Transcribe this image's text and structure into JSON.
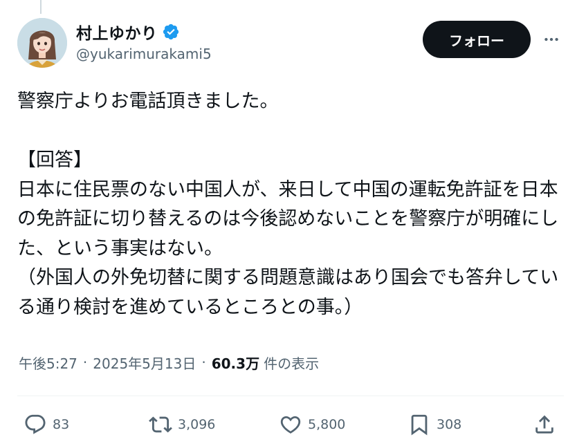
{
  "author": {
    "display_name": "村上ゆかり",
    "handle": "@yukarimurakami5",
    "verified": true,
    "avatar_icon": "profile-avatar-illustration"
  },
  "header": {
    "follow_label": "フォロー",
    "more_icon": "more-horizontal-icon"
  },
  "tweet": {
    "text": "警察庁よりお電話頂きました。\n\n【回答】\n日本に住民票のない中国人が、来日して中国の運転免許証を日本の免許証に切り替えるのは今後認めないことを警察庁が明確にした、という事実はない。\n（外国人の外免切替に関する問題意識はあり国会でも答弁している通り検討を進めているところとの事。）"
  },
  "meta": {
    "time": "午後5:27",
    "separator": "·",
    "date": "2025年5月13日",
    "views_count": "60.3万",
    "views_label": "件の表示"
  },
  "actions": {
    "reply_count": "83",
    "retweet_count": "3,096",
    "like_count": "5,800",
    "bookmark_count": "308"
  },
  "colors": {
    "text_primary": "#0f1419",
    "text_secondary": "#536471",
    "verified_blue": "#1d9bf0",
    "follow_bg": "#0f1419",
    "divider": "#eff3f4"
  }
}
